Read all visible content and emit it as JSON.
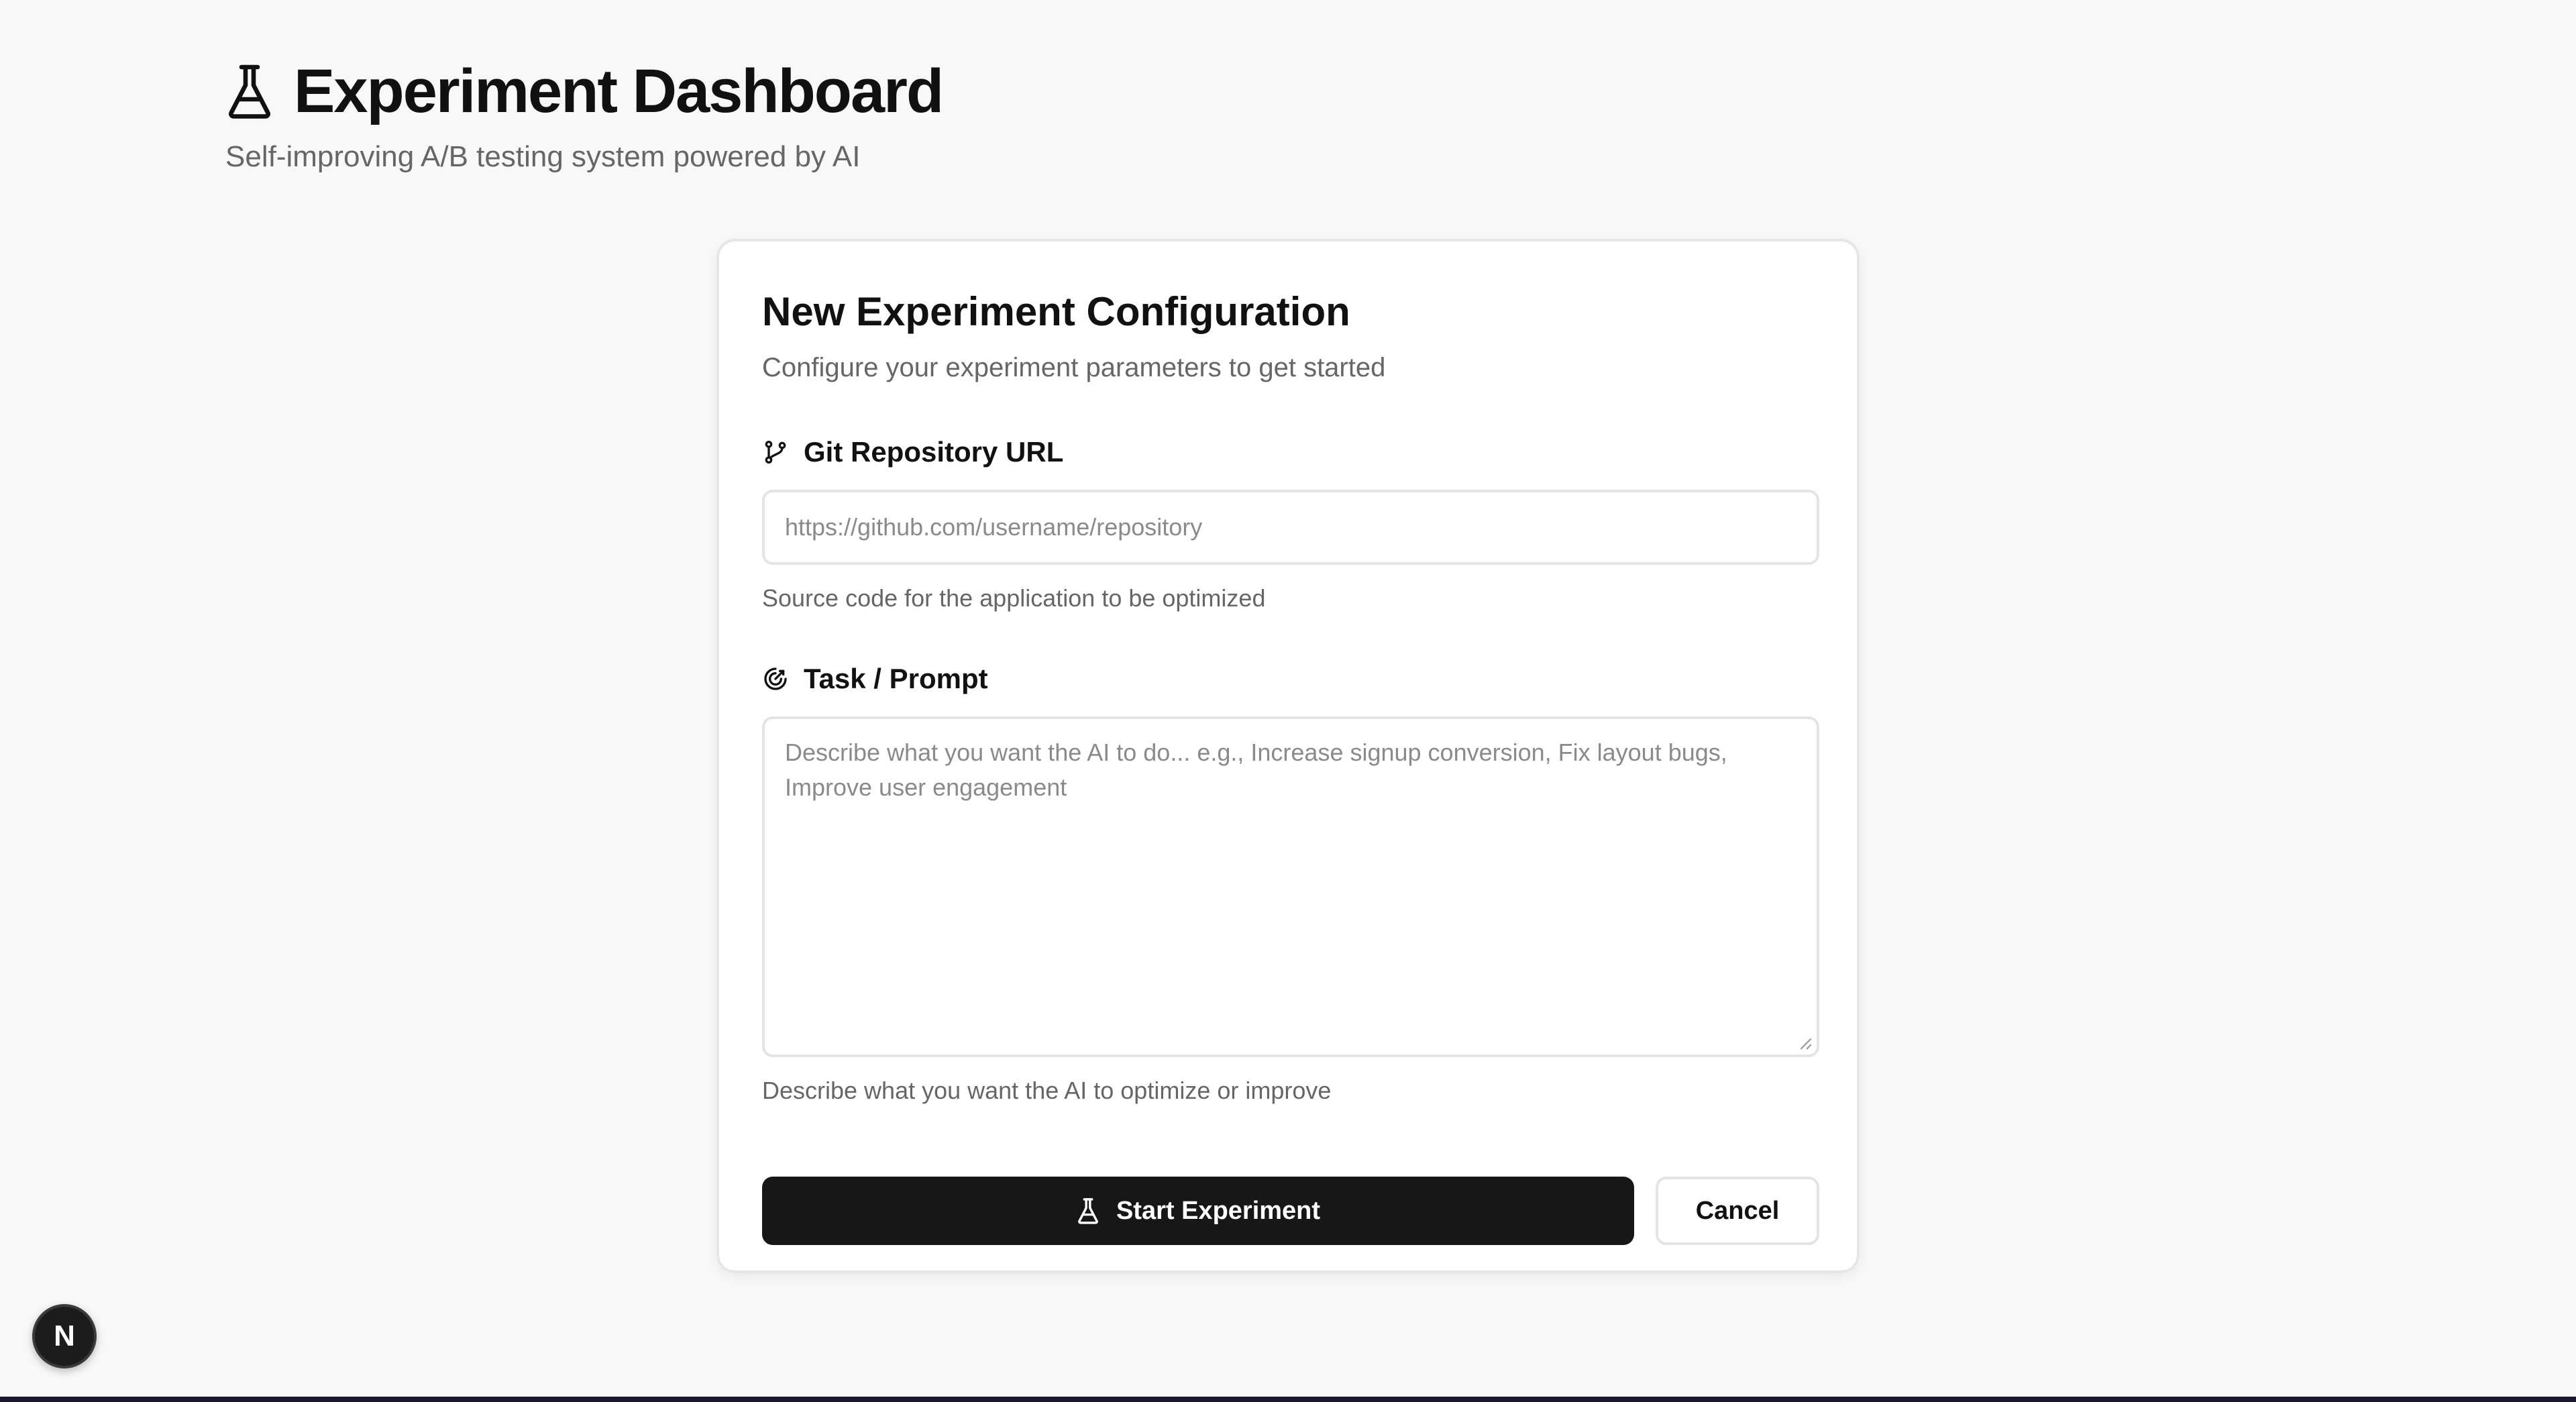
{
  "header": {
    "title": "Experiment Dashboard",
    "subtitle": "Self-improving A/B testing system powered by AI",
    "icon": "flask-icon"
  },
  "form": {
    "title": "New Experiment Configuration",
    "description": "Configure your experiment parameters to get started",
    "repo": {
      "label": "Git Repository URL",
      "icon": "git-branch-icon",
      "placeholder": "https://github.com/username/repository",
      "hint": "Source code for the application to be optimized"
    },
    "task": {
      "label": "Task / Prompt",
      "icon": "target-icon",
      "placeholder": "Describe what you want the AI to do... e.g., Increase signup conversion, Fix layout bugs, Improve user engagement",
      "hint": "Describe what you want the AI to optimize or improve"
    },
    "start_label": "Start Experiment",
    "cancel_label": "Cancel"
  },
  "badge": {
    "label": "N"
  },
  "colors": {
    "background": "#f8f8f8",
    "primary_button": "#171717",
    "muted_text": "#666666",
    "border": "#e4e4e4"
  }
}
